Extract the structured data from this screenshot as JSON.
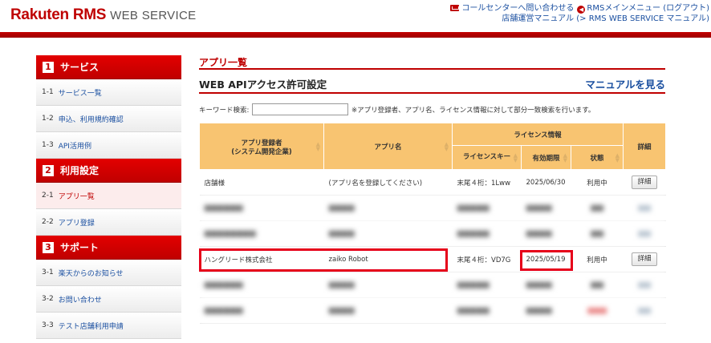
{
  "header": {
    "logo_main": "Rakuten RMS",
    "logo_sub": "WEB SERVICE",
    "link_callcenter": "コールセンターへ問い合わせる",
    "link_rms_menu": "RMSメインメニュー (ログアウト)",
    "link_manual": "店舗運営マニュアル (> RMS WEB SERVICE マニュアル)",
    "back_icon_glyph": "◀"
  },
  "sidebar": {
    "sections": [
      {
        "num": "1",
        "title": "サービス",
        "items": [
          {
            "num": "1-1",
            "label": "サービス一覧"
          },
          {
            "num": "1-2",
            "label": "申込、利用規約確認"
          },
          {
            "num": "1-3",
            "label": "API活用例"
          }
        ]
      },
      {
        "num": "2",
        "title": "利用設定",
        "items": [
          {
            "num": "2-1",
            "label": "アプリ一覧"
          },
          {
            "num": "2-2",
            "label": "アプリ登録"
          }
        ]
      },
      {
        "num": "3",
        "title": "サポート",
        "items": [
          {
            "num": "3-1",
            "label": "楽天からのお知らせ"
          },
          {
            "num": "3-2",
            "label": "お問い合わせ"
          },
          {
            "num": "3-3",
            "label": "テスト店舗利用申請"
          }
        ]
      }
    ]
  },
  "main": {
    "breadcrumb": "アプリ一覧",
    "title": "WEB APIアクセス許可設定",
    "manual_link": "マニュアルを見る",
    "search_label": "キーワード検索:",
    "search_value": "",
    "search_note": "※アプリ登録者、アプリ名、ライセンス情報に対して部分一致検索を行います。",
    "table": {
      "headers": {
        "registrant": "アプリ登録者\n(システム開発企業)",
        "app_name": "アプリ名",
        "license_group": "ライセンス情報",
        "license_key": "ライセンスキー",
        "expiry": "有効期限",
        "status": "状態",
        "detail": "詳細"
      },
      "rows": [
        {
          "registrant": "店舗様",
          "app_name": "(アプリ名を登録してください)",
          "license_key": "末尾４桁：1Lww",
          "expiry": "2025/06/30",
          "status": "利用中",
          "detail": "詳細",
          "blurred": false
        },
        {
          "registrant": "■■■■■■",
          "app_name": "■■■■",
          "license_key": "■■■■■",
          "expiry": "■■■■",
          "status": "■■",
          "detail": "■■",
          "blurred": true
        },
        {
          "registrant": "■■■■■■■■",
          "app_name": "■■■■",
          "license_key": "■■■■■",
          "expiry": "■■■■",
          "status": "■■",
          "detail": "■■",
          "blurred": true
        },
        {
          "registrant": "ハングリード株式会社",
          "app_name": "zaiko Robot",
          "license_key": "末尾４桁：VD7G",
          "expiry": "2025/05/19",
          "status": "利用中",
          "detail": "詳細",
          "blurred": false
        },
        {
          "registrant": "■■■■■■",
          "app_name": "■■■■",
          "license_key": "■■■■■",
          "expiry": "■■■■",
          "status": "■■",
          "detail": "■■",
          "blurred": true
        },
        {
          "registrant": "■■■■■■",
          "app_name": "■■■■",
          "license_key": "■■■■■",
          "expiry": "■■■■",
          "status": "■■■",
          "detail": "■■",
          "blurred": true
        }
      ]
    }
  },
  "colors": {
    "brand_red": "#bf0000",
    "table_header": "#f8c471",
    "link_blue": "#1a4fa0",
    "status_green": "#2a9c2a",
    "highlight": "#e6001a"
  }
}
